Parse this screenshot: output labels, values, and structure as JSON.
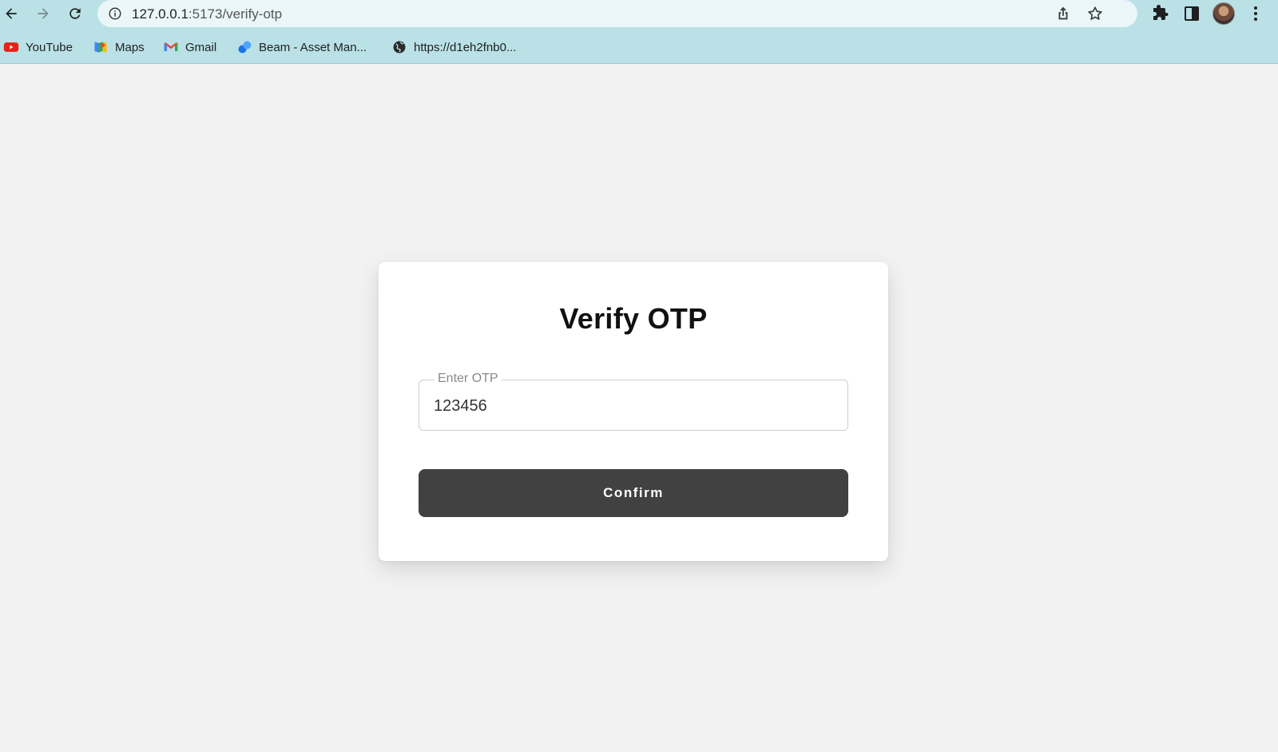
{
  "browser": {
    "url_host": "127.0.0.1",
    "url_path": ":5173/verify-otp",
    "bookmarks": [
      {
        "label": "YouTube",
        "icon": "youtube-icon"
      },
      {
        "label": "Maps",
        "icon": "maps-icon"
      },
      {
        "label": "Gmail",
        "icon": "gmail-icon"
      },
      {
        "label": "Beam - Asset Man...",
        "icon": "beam-icon"
      },
      {
        "label": "https://d1eh2fnb0...",
        "icon": "globe-icon"
      }
    ],
    "colors": {
      "chrome_bg": "#b9e1e6",
      "omnibox_bg": "#eaf6f8"
    }
  },
  "page": {
    "title": "Verify OTP",
    "otp_field": {
      "label": "Enter OTP",
      "value": "123456"
    },
    "confirm_label": "Confirm",
    "colors": {
      "button_bg": "#414141",
      "page_bg": "#f2f2f2"
    }
  }
}
